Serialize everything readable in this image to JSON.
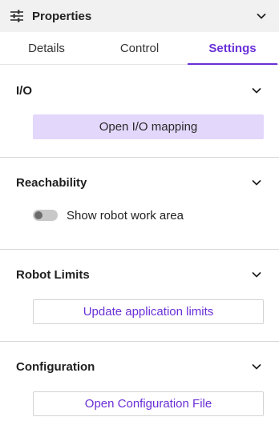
{
  "header": {
    "title": "Properties",
    "icon": "sliders-icon"
  },
  "tabs": [
    {
      "label": "Details",
      "active": false
    },
    {
      "label": "Control",
      "active": false
    },
    {
      "label": "Settings",
      "active": true
    }
  ],
  "sections": {
    "io": {
      "title": "I/O",
      "button_label": "Open I/O mapping"
    },
    "reachability": {
      "title": "Reachability",
      "toggle_label": "Show robot work area",
      "toggle_on": false
    },
    "robot_limits": {
      "title": "Robot Limits",
      "button_label": "Update application limits"
    },
    "configuration": {
      "title": "Configuration",
      "button_label": "Open Configuration File"
    }
  },
  "colors": {
    "accent": "#6a2fd6",
    "header_bg": "#f1f1f1",
    "soft_button_bg": "#e3d7fb"
  }
}
